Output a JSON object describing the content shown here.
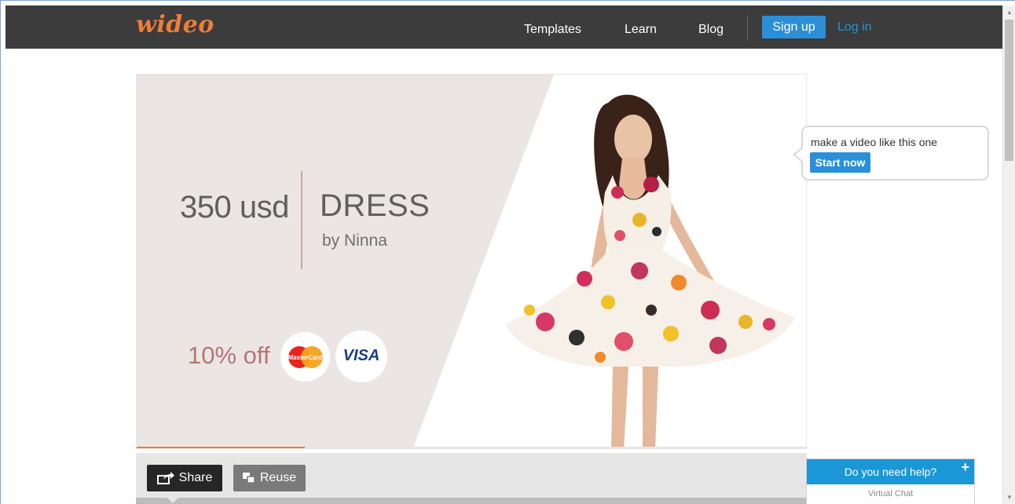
{
  "header": {
    "logo": "wideo",
    "nav": [
      "Templates",
      "Learn",
      "Blog"
    ],
    "signup_label": "Sign up",
    "login_label": "Log in"
  },
  "video": {
    "price": "350 usd",
    "product": "DRESS",
    "brand": "by Ninna",
    "discount": "10% off",
    "card_brands": [
      "MasterCard",
      "VISA"
    ],
    "progress": 0.25
  },
  "callout": {
    "text": "make a video like this one",
    "button_label": "Start now"
  },
  "controls": {
    "share_label": "Share",
    "reuse_label": "Reuse"
  },
  "help": {
    "title": "Do you need help?",
    "subtitle": "Virtual Chat",
    "plus": "+"
  },
  "colors": {
    "nav_bg": "#3c3c3c",
    "accent_orange": "#ef7d35",
    "accent_blue": "#2b8fd7",
    "video_panel": "#ebe6e3",
    "help_blue": "#1997d7"
  },
  "icons": {
    "share": "share-icon",
    "reuse": "reuse-icon",
    "dress_photo": "woman-in-floral-dress"
  }
}
